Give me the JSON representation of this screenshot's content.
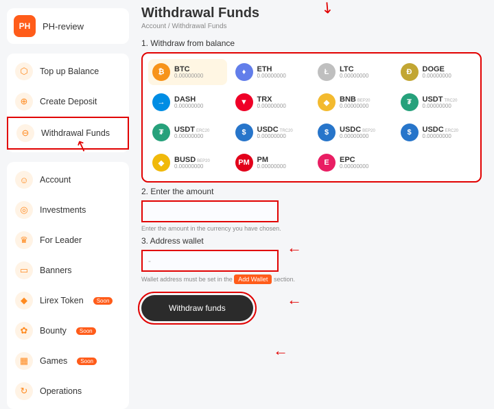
{
  "user": {
    "initials": "PH",
    "name": "PH-review"
  },
  "sidebar": {
    "group1": [
      {
        "label": "Top up Balance",
        "icon": "⬡"
      },
      {
        "label": "Create Deposit",
        "icon": "⊕"
      },
      {
        "label": "Withdrawal Funds",
        "icon": "⊖"
      }
    ],
    "group2": [
      {
        "label": "Account",
        "icon": "☺"
      },
      {
        "label": "Investments",
        "icon": "◎"
      },
      {
        "label": "For Leader",
        "icon": "♛"
      },
      {
        "label": "Banners",
        "icon": "▭"
      },
      {
        "label": "Lirex Token",
        "icon": "◆",
        "soon": "Soon"
      },
      {
        "label": "Bounty",
        "icon": "✿",
        "soon": "Soon"
      },
      {
        "label": "Games",
        "icon": "▦",
        "soon": "Soon"
      },
      {
        "label": "Operations",
        "icon": "↻"
      }
    ]
  },
  "page": {
    "title": "Withdrawal Funds",
    "breadcrumb_account": "Account",
    "breadcrumb_sep": " / ",
    "breadcrumb_current": "Withdrawal Funds",
    "step1": "1. Withdraw from balance",
    "step2": "2. Enter the amount",
    "step2_help": "Enter the amount in the currency you have chosen.",
    "step3": "3. Address wallet",
    "address_placeholder": "-",
    "step3_help_pre": "Wallet address must be set in the ",
    "step3_help_post": " section.",
    "add_wallet": "Add Wallet",
    "submit": "Withdraw funds"
  },
  "currencies": [
    {
      "sym": "BTC",
      "tag": "",
      "bal": "0.00000000",
      "color": "coin-btc",
      "glyph": "₿",
      "selected": true
    },
    {
      "sym": "ETH",
      "tag": "",
      "bal": "0.00000000",
      "color": "coin-eth",
      "glyph": "♦"
    },
    {
      "sym": "LTC",
      "tag": "",
      "bal": "0.00000000",
      "color": "coin-ltc",
      "glyph": "Ł"
    },
    {
      "sym": "DOGE",
      "tag": "",
      "bal": "0.00000000",
      "color": "coin-doge",
      "glyph": "Ð"
    },
    {
      "sym": "DASH",
      "tag": "",
      "bal": "0.00000000",
      "color": "coin-dash",
      "glyph": "→"
    },
    {
      "sym": "TRX",
      "tag": "",
      "bal": "0.00000000",
      "color": "coin-trx",
      "glyph": "▼"
    },
    {
      "sym": "BNB",
      "tag": "BEP20",
      "bal": "0.00000000",
      "color": "coin-bnb",
      "glyph": "◆"
    },
    {
      "sym": "USDT",
      "tag": "TRC20",
      "bal": "0.00000000",
      "color": "coin-usdt",
      "glyph": "₮"
    },
    {
      "sym": "USDT",
      "tag": "ERC20",
      "bal": "0.00000000",
      "color": "coin-usdt",
      "glyph": "₮"
    },
    {
      "sym": "USDC",
      "tag": "TRC20",
      "bal": "0.00000000",
      "color": "coin-usdc",
      "glyph": "$"
    },
    {
      "sym": "USDC",
      "tag": "BEP20",
      "bal": "0.00000000",
      "color": "coin-usdc",
      "glyph": "$"
    },
    {
      "sym": "USDC",
      "tag": "ERC20",
      "bal": "0.00000000",
      "color": "coin-usdc",
      "glyph": "$"
    },
    {
      "sym": "BUSD",
      "tag": "BEP20",
      "bal": "0.00000000",
      "color": "coin-busd",
      "glyph": "◆"
    },
    {
      "sym": "PM",
      "tag": "",
      "bal": "0.00000000",
      "color": "coin-pm",
      "glyph": "PM"
    },
    {
      "sym": "EPC",
      "tag": "",
      "bal": "0.00000000",
      "color": "coin-epc",
      "glyph": "E"
    }
  ]
}
